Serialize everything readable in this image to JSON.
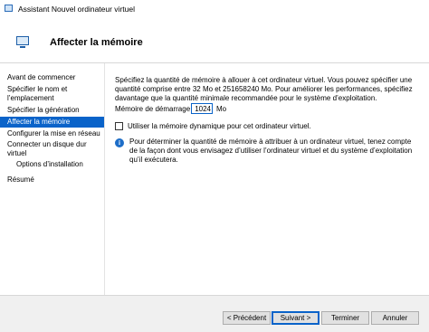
{
  "window": {
    "title": "Assistant Nouvel ordinateur virtuel",
    "icon": "vm-wizard-icon"
  },
  "header": {
    "title": "Affecter la mémoire",
    "icon": "memory-icon"
  },
  "sidebar": {
    "items": [
      {
        "label": "Avant de commencer",
        "active": false,
        "sub": false
      },
      {
        "label": "Spécifier le nom et l’emplacement",
        "active": false,
        "sub": false
      },
      {
        "label": "Spécifier la génération",
        "active": false,
        "sub": false
      },
      {
        "label": "Affecter la mémoire",
        "active": true,
        "sub": false
      },
      {
        "label": "Configurer la mise en réseau",
        "active": false,
        "sub": false
      },
      {
        "label": "Connecter un disque dur virtuel",
        "active": false,
        "sub": false
      },
      {
        "label": "Options d’installation",
        "active": false,
        "sub": true
      },
      {
        "label": "Résumé",
        "active": false,
        "sub": false
      }
    ]
  },
  "main": {
    "intro": "Spécifiez la quantité de mémoire à allouer à cet ordinateur virtuel. Vous pouvez spécifier une quantité comprise entre 32 Mo et 251658240 Mo. Pour améliorer les performances, spécifiez davantage que la quantité minimale recommandée pour le système d’exploitation.",
    "memory_label": "Mémoire de démarrage :",
    "memory_value": "1024",
    "memory_unit": "Mo",
    "dynamic_memory_label": "Utiliser la mémoire dynamique pour cet ordinateur virtuel.",
    "dynamic_memory_checked": false,
    "info_text": "Pour déterminer la quantité de mémoire à attribuer à un ordinateur virtuel, tenez compte de la façon dont vous envisagez d’utiliser l’ordinateur virtuel et du système d’exploitation qu’il exécutera."
  },
  "footer": {
    "prev_label": "< Précédent",
    "next_label": "Suivant >",
    "finish_label": "Terminer",
    "cancel_label": "Annuler"
  },
  "colors": {
    "accent": "#0a63c9",
    "info": "#1e6ec8",
    "footer_bg": "#f0f0f0"
  }
}
